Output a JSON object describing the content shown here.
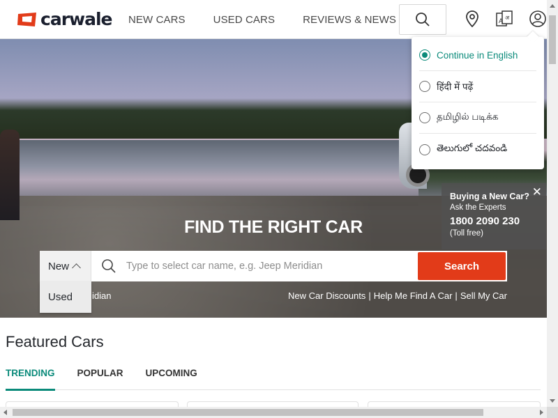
{
  "brand": {
    "logo_text": "carwale",
    "accent": "#e23b19",
    "teal": "#0a8a7a"
  },
  "nav": {
    "items": [
      "NEW CARS",
      "USED CARS",
      "REVIEWS & NEWS"
    ]
  },
  "header_icons": [
    "search-icon",
    "location-pin-icon",
    "language-icon",
    "profile-icon"
  ],
  "language_menu": {
    "options": [
      {
        "label": "Continue in English",
        "selected": true
      },
      {
        "label": "हिंदी में पढ़ें",
        "selected": false
      },
      {
        "label": "தமிழில் படிக்க",
        "selected": false
      },
      {
        "label": "తెలుగులో చదవండి",
        "selected": false
      }
    ]
  },
  "hero": {
    "title": "FIND THE RIGHT CAR",
    "type_selected": "New",
    "type_options": [
      "Used"
    ],
    "search_placeholder": "Type to select car name, e.g. Jeep Meridian",
    "search_button": "Search",
    "below_left": "idian",
    "quick_links": [
      "New Car Discounts",
      "Help Me Find A Car",
      "Sell My Car"
    ]
  },
  "buy_card": {
    "title": "Buying a New Car?",
    "subtitle": "Ask the Experts",
    "phone": "1800 2090 230",
    "note": "(Toll free)",
    "close": "✕"
  },
  "featured": {
    "title": "Featured Cars",
    "tabs": [
      {
        "label": "TRENDING",
        "active": true
      },
      {
        "label": "POPULAR",
        "active": false
      },
      {
        "label": "UPCOMING",
        "active": false
      }
    ]
  }
}
